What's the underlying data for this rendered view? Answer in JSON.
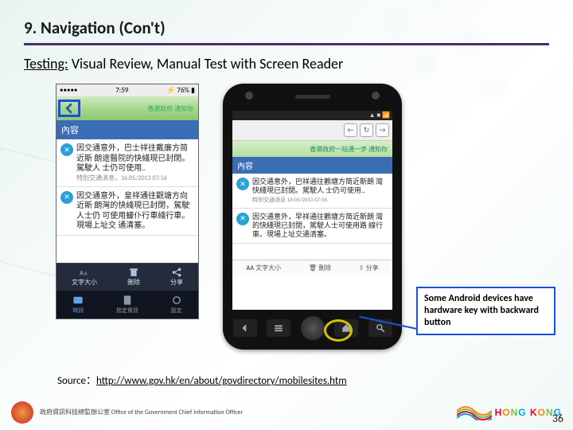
{
  "slide": {
    "title": "9. Navigation (Con't)",
    "subtitle_lead": "Testing:",
    "subtitle_rest": " Visual Review, Manual Test with Screen Reader",
    "callout": "Some Android devices have hardware key with backward button",
    "source_prefix": "Source：",
    "source_url": "http://www.gov.hk/en/about/govdirectory/mobilesites.htm",
    "page_number": "36",
    "footer_org": "政府資訊科技總監辦公室\nOffice of the Government Chief Information Officer"
  },
  "iphone": {
    "status_time": "7:59",
    "status_batt": "76%",
    "brand_top": "香港政府\n通知你",
    "section": "內容",
    "item1": "因交通意外，巴士祥往戴廉方简近斯 朗途醫院的快綫現已封閉。駕駛人\n士仍可使用..",
    "item1_meta": "特別交通消息，16:05/2013 07:56",
    "item2": "因交通意外，皇祥通往觀塘方向近斯 朗灣的快綫現已封閉，駕駛人士仍\n可使用蠔仆行車綫行車。現場上址交\n通清塞。",
    "tool_font": "文字大小",
    "tool_del": "刪除",
    "tool_share": "分享",
    "tab1": "時訊",
    "tab2": "指定資訊",
    "tab3": "設定"
  },
  "android": {
    "banner": "香港政府一站通一步 通知你",
    "section": "內容",
    "item1": "因交通意外，巴祥通往觀塘方简近斯朗\n灣快綫現已封閉。駕駛人\n士仍可使用..",
    "item1_meta": "特別交通消息 16:05/2013 07:56",
    "item2": "因交通意外，早祥通往觀塘方简近斯朗\n灣的快綫現已封閉，駕駛人士可使用路\n線行車。現場上址交通清塞。",
    "tool_font": "文字大小",
    "tool_del": "刪除",
    "tool_share": "分享"
  }
}
